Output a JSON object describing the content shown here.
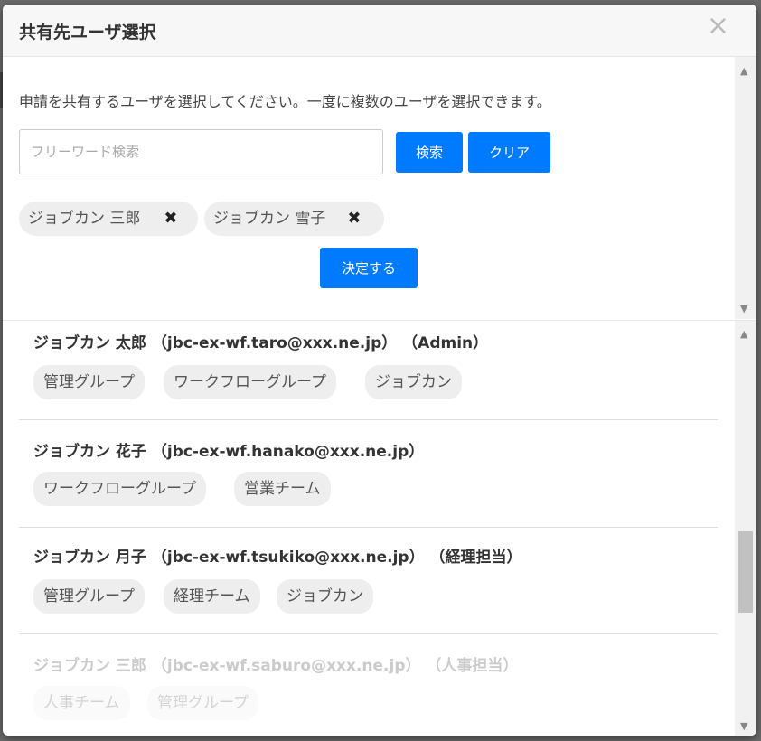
{
  "dialog": {
    "title": "共有先ユーザ選択",
    "close_glyph": "×"
  },
  "description": "申請を共有するユーザを選択してください。一度に複数のユーザを選択できます。",
  "search": {
    "placeholder": "フリーワード検索",
    "value": "",
    "search_label": "検索",
    "clear_label": "クリア"
  },
  "selected": [
    {
      "name": "ジョブカン 三郎",
      "remove_icon": "close-icon",
      "remove_glyph": "✖"
    },
    {
      "name": "ジョブカン 雪子",
      "remove_icon": "close-icon",
      "remove_glyph": "✖"
    }
  ],
  "decide_label": "決定する",
  "users": [
    {
      "header": "ジョブカン 太郎 （jbc-ex-wf.taro@xxx.ne.jp） （Admin）",
      "groups": [
        "管理グループ",
        "ワークフローグループ",
        "ジョブカン"
      ],
      "disabled": false
    },
    {
      "header": "ジョブカン 花子 （jbc-ex-wf.hanako@xxx.ne.jp）",
      "groups": [
        "ワークフローグループ",
        "営業チーム"
      ],
      "disabled": false
    },
    {
      "header": "ジョブカン 月子 （jbc-ex-wf.tsukiko@xxx.ne.jp） （経理担当）",
      "groups": [
        "管理グループ",
        "経理チーム",
        "ジョブカン"
      ],
      "disabled": false
    },
    {
      "header": "ジョブカン 三郎 （jbc-ex-wf.saburo@xxx.ne.jp） （人事担当）",
      "groups": [
        "人事チーム",
        "管理グループ"
      ],
      "disabled": true
    }
  ],
  "scroll_arrows": {
    "up": "▲",
    "down": "▼"
  },
  "colors": {
    "accent": "#007bff",
    "chip_bg": "#eeeeee"
  }
}
